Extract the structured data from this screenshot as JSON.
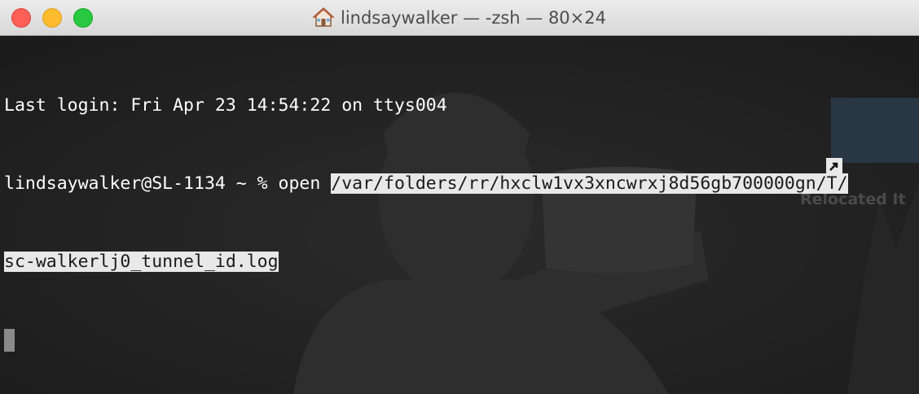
{
  "window": {
    "title": "lindsaywalker — -zsh — 80×24",
    "title_icon": "home-icon"
  },
  "traffic_lights": {
    "close_color": "#fe5f57",
    "minimize_color": "#febc2e",
    "maximize_color": "#28c840"
  },
  "terminal": {
    "line1": "Last login: Fri Apr 23 14:54:22 on ttys004",
    "prompt": "lindsaywalker@SL-1134 ~ % open ",
    "selected_path_part1": "/var/folders/rr/hxclw1vx3xncwrxj8d56gb700000gn/T/",
    "selected_path_part2": "sc-walkerlj0_tunnel_id.log",
    "text_color": "#ffffff",
    "selection_color": "#e8e8e8"
  },
  "desktop": {
    "label": "Relocated It"
  }
}
